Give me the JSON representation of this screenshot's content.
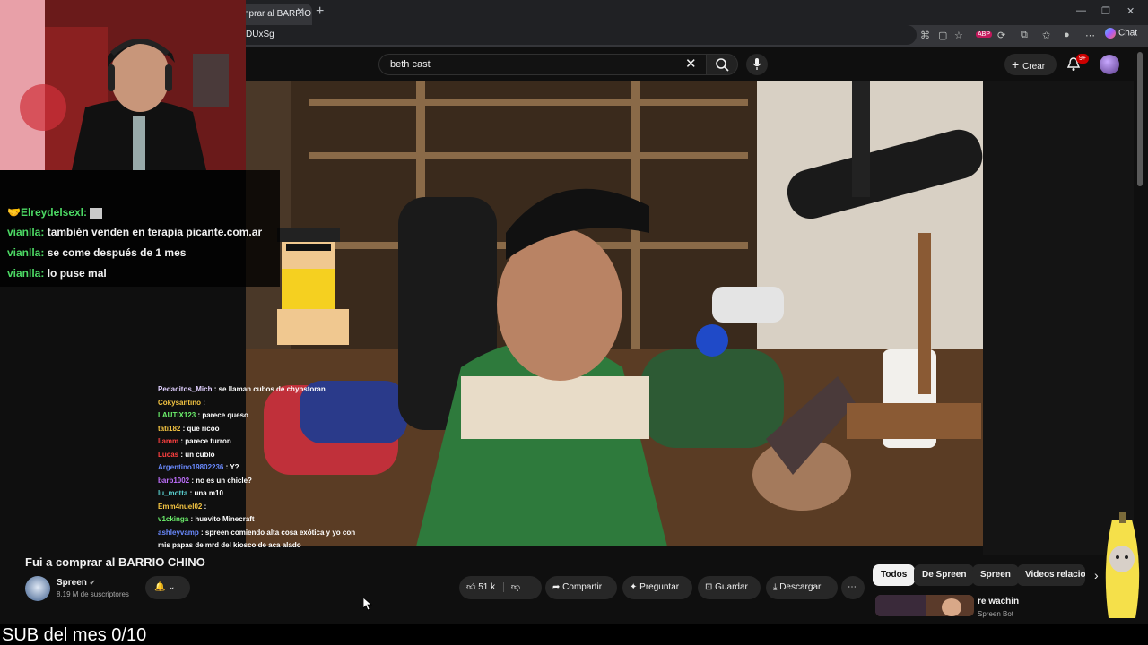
{
  "browser": {
    "tab_title": "nprar al BARRIO",
    "url_fragment": "DUxSg",
    "chat_label": "Chat"
  },
  "youtube": {
    "search_query": "beth cast",
    "create_label": "Crear",
    "notifications_badge": "9+"
  },
  "stream_chat": [
    {
      "user": "Elreydelsexl:",
      "text": "",
      "color": "#4cd964"
    },
    {
      "user": "vianlla:",
      "text": "también venden en terapia picante.com.ar",
      "color": "#4cd964"
    },
    {
      "user": "vianlla:",
      "text": "se come después de 1 mes",
      "color": "#4cd964"
    },
    {
      "user": "vianlla:",
      "text": "lo puse mal",
      "color": "#4cd964"
    }
  ],
  "video_chat": [
    {
      "user": "Pedacitos_Mich",
      "text": " : se llaman cubos de chypstoran"
    },
    {
      "user": "Cokysantino",
      "text": " : "
    },
    {
      "user": "LAUTIX123",
      "text": " : parece queso"
    },
    {
      "user": "tati182",
      "text": " : que ricoo"
    },
    {
      "user": "liamm",
      "text": " : parece turron"
    },
    {
      "user": "Lucas",
      "text": " : un cublo"
    },
    {
      "user": "Argentino19802236",
      "text": " : Y?"
    },
    {
      "user": "barb1002",
      "text": " : no es un chicle?"
    },
    {
      "user": "lu_motta",
      "text": " : una m10"
    },
    {
      "user": "Emm4nuel02",
      "text": " : "
    },
    {
      "user": "v1ckinga",
      "text": " : huevito Minecraft"
    },
    {
      "user": "ashleyvamp",
      "text": " : spreen comiendo alta cosa exótica y yo con"
    },
    {
      "user": "",
      "text": "mis papas de mrd del kiosco de aca alado"
    }
  ],
  "video": {
    "title": "Fui a comprar al BARRIO CHINO",
    "channel": "Spreen",
    "subscribers": "8.19 M de suscriptores",
    "likes": "51 k",
    "share_label": "Compartir",
    "ask_label": "Preguntar",
    "save_label": "Guardar",
    "download_label": "Descargar"
  },
  "chips": [
    "Todos",
    "De Spreen",
    "Spreen",
    "Videos relacio"
  ],
  "recommended": {
    "title": "re wachin",
    "sub": "Spreen Bot"
  },
  "overlay_text": "SUB del mes 0/10"
}
